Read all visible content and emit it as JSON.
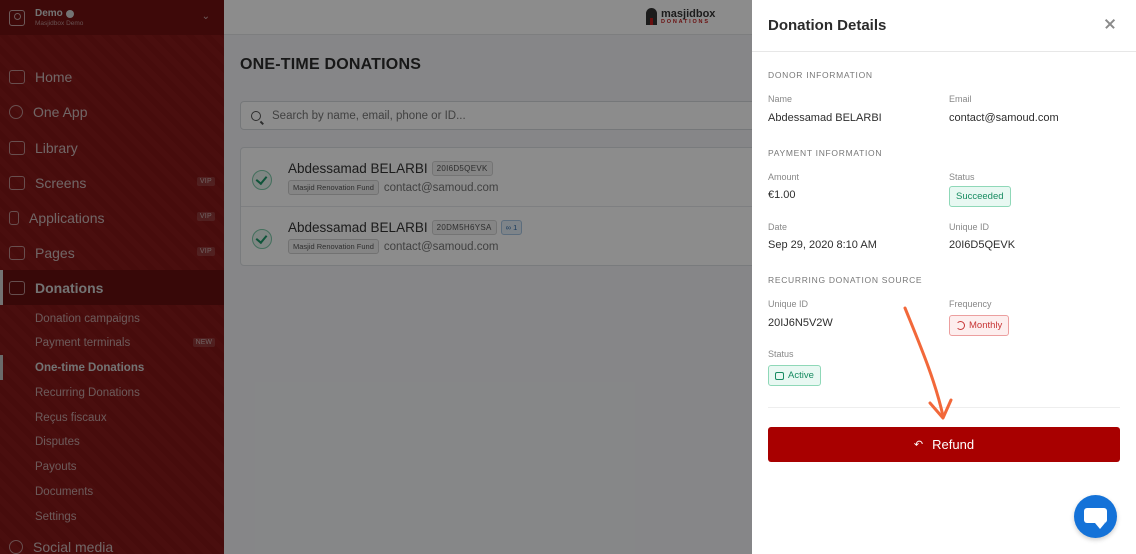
{
  "account": {
    "name": "Demo",
    "subtitle": "Masjidbox Demo"
  },
  "sidebar": {
    "items": [
      {
        "label": "Home",
        "icon": "home-icon"
      },
      {
        "label": "One App",
        "icon": "app-icon"
      },
      {
        "label": "Library",
        "icon": "library-icon"
      },
      {
        "label": "Screens",
        "icon": "tv-icon",
        "badge": "VIP"
      },
      {
        "label": "Applications",
        "icon": "phone-icon",
        "badge": "VIP"
      },
      {
        "label": "Pages",
        "icon": "page-icon",
        "badge": "VIP"
      },
      {
        "label": "Donations",
        "icon": "donation-icon",
        "active": true
      }
    ],
    "sub_items": [
      {
        "label": "Donation campaigns"
      },
      {
        "label": "Payment terminals",
        "badge": "NEW"
      },
      {
        "label": "One-time Donations",
        "active": true
      },
      {
        "label": "Recurring Donations"
      },
      {
        "label": "Reçus fiscaux"
      },
      {
        "label": "Disputes"
      },
      {
        "label": "Payouts"
      },
      {
        "label": "Documents"
      },
      {
        "label": "Settings"
      }
    ],
    "bottom_item": {
      "label": "Social media",
      "icon": "social-icon"
    }
  },
  "topbar": {
    "logo_name": "masjidbox",
    "logo_tag": "DONATIONS"
  },
  "main": {
    "title": "ONE-TIME DONATIONS",
    "search_placeholder": "Search by name, email, phone or ID...",
    "rows": [
      {
        "name": "Abdessamad BELARBI",
        "code": "20I6D5QEVK",
        "fund": "Masjid Renovation Fund",
        "email": "contact@samoud.com",
        "link_count": ""
      },
      {
        "name": "Abdessamad BELARBI",
        "code": "20DM5H6YSA",
        "fund": "Masjid Renovation Fund",
        "email": "contact@samoud.com",
        "link_count": "1"
      }
    ]
  },
  "panel": {
    "title": "Donation Details",
    "donor_section": "DONOR INFORMATION",
    "name_label": "Name",
    "name_value": "Abdessamad BELARBI",
    "email_label": "Email",
    "email_value": "contact@samoud.com",
    "payment_section": "PAYMENT INFORMATION",
    "amount_label": "Amount",
    "amount_value": "€1.00",
    "status_label": "Status",
    "status_value": "Succeeded",
    "date_label": "Date",
    "date_value": "Sep 29, 2020 8:10 AM",
    "uid_label": "Unique ID",
    "uid_value": "20I6D5QEVK",
    "recurring_section": "RECURRING DONATION SOURCE",
    "rec_uid_label": "Unique ID",
    "rec_uid_value": "20IJ6N5V2W",
    "frequency_label": "Frequency",
    "frequency_value": "Monthly",
    "rec_status_label": "Status",
    "rec_status_value": "Active",
    "refund_label": "Refund"
  },
  "colors": {
    "brand": "#a31d1d",
    "refund": "#a80000",
    "chat": "#1472d8",
    "arrow": "#f2683a"
  }
}
